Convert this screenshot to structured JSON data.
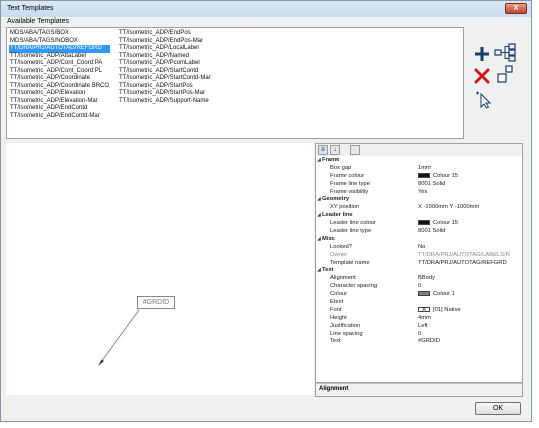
{
  "window": {
    "title": "Text Templates",
    "close_glyph": "X"
  },
  "templates": {
    "label": "Available Templates",
    "col1": [
      "MDS/ABA/TAGS/BOX",
      "MDS/ABA/TAGS/NOBOX",
      "TT/DRA/PRJ/AUTOTAG/REFGRD",
      "TT/Isometric_ADP/AttaLabel",
      "TT/Isometric_ADP/Cont_Coord:PA",
      "TT/Isometric_ADP/Cont_Coord:PL",
      "TT/Isometric_ADP/Coordinate",
      "TT/Isometric_ADP/Coordinate BRCO",
      "TT/Isometric_ADP/Elevation",
      "TT/Isometric_ADP/Elevation-Mar",
      "TT/Isometric_ADP/EndContd",
      "TT/Isometric_ADP/EndContd-Mar"
    ],
    "col2": [
      "TT/Isometric_ADP/EndPos",
      "TT/Isometric_ADP/EndPos-Mar",
      "TT/Isometric_ADP/LocalLabel",
      "TT/Isometric_ADP/Named",
      "TT/Isometric_ADP/PcomLabel",
      "TT/Isometric_ADP/StartContd",
      "TT/Isometric_ADP/StartContd-Mar",
      "TT/Isometric_ADP/StartPos",
      "TT/Isometric_ADP/StartPos-Mar",
      "TT/Isometric_ADP/Support-Name"
    ]
  },
  "preview": {
    "tag_text": "#GRDID"
  },
  "properties": [
    {
      "kind": "cat",
      "name": "Frame"
    },
    {
      "name": "Box gap",
      "value": "1mm"
    },
    {
      "name": "Frame colour",
      "value": "Colour 15",
      "swatch": "#111111"
    },
    {
      "name": "Frame line type",
      "value": "8001 Solid"
    },
    {
      "name": "Frame visibility",
      "value": "Yes"
    },
    {
      "kind": "cat",
      "name": "Geometry"
    },
    {
      "name": "XY position",
      "value": "X -1000mm Y -1000mm"
    },
    {
      "kind": "cat",
      "name": "Leader line"
    },
    {
      "name": "Leader line colour",
      "value": "Colour 15",
      "swatch": "#111111"
    },
    {
      "name": "Leader line type",
      "value": "8001 Solid"
    },
    {
      "kind": "cat",
      "name": "Misc"
    },
    {
      "name": "Locked?",
      "value": "No"
    },
    {
      "name": "Owner",
      "value": "TT/DRA/PRJ/AUTOTAG/LABELS/R",
      "dim": true
    },
    {
      "name": "Template name",
      "value": "TT/DRA/PRJ/AUTOTAG/REFGRD"
    },
    {
      "kind": "cat",
      "name": "Text"
    },
    {
      "name": "Alignment",
      "value": "BBody"
    },
    {
      "name": "Character spacing",
      "value": "0"
    },
    {
      "name": "Colour",
      "value": "Colour 1",
      "swatch": "#808080"
    },
    {
      "name": "Etext",
      "value": ""
    },
    {
      "name": "Font",
      "value": "[01] Native",
      "font_icon": true
    },
    {
      "name": "Height",
      "value": "4mm"
    },
    {
      "name": "Justification",
      "value": "Left"
    },
    {
      "name": "Line spacing",
      "value": "0"
    },
    {
      "name": "Text",
      "value": "#GRDID"
    }
  ],
  "description": {
    "title": "Alignment"
  },
  "buttons": {
    "ok": "OK"
  },
  "colors": {
    "selection": "#3399ff",
    "add": "#1a3a6a",
    "delete": "#cc1a1a"
  },
  "icons": [
    "add-icon",
    "tree-structure-icon",
    "delete-icon",
    "resize-icon",
    "pointer-icon",
    "categorized-icon",
    "alphabetical-sort-icon",
    "property-pages-icon",
    "font-icon"
  ]
}
